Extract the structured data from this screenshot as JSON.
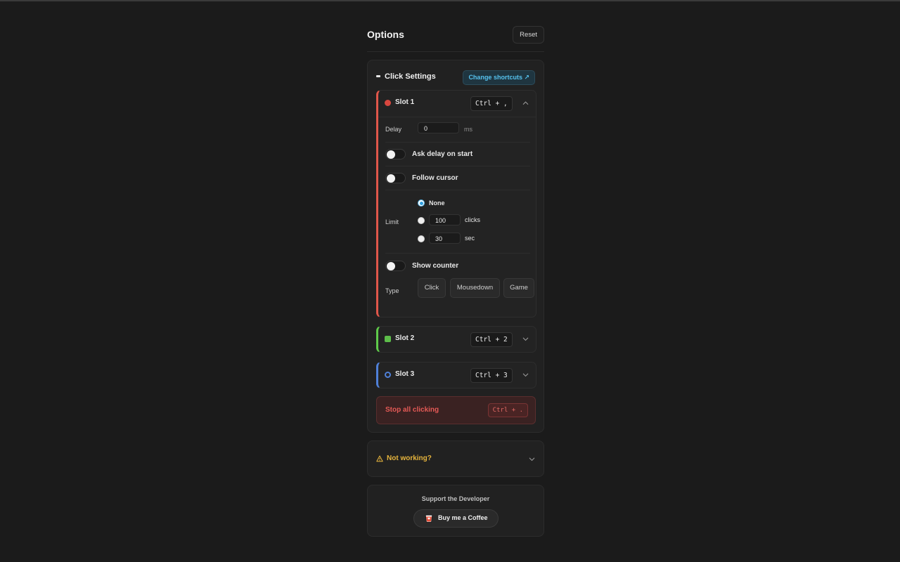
{
  "header": {
    "title": "Options",
    "reset_label": "Reset"
  },
  "click_settings": {
    "title": "Click Settings",
    "change_shortcuts_label": "Change shortcuts ↗",
    "slots": [
      {
        "name": "Slot 1",
        "shortcut": "Ctrl + ,",
        "color": "#d8473f",
        "expanded": true,
        "delay": {
          "label": "Delay",
          "value": "0",
          "unit": "ms"
        },
        "ask_delay_on_start": {
          "label": "Ask delay on start",
          "on": false
        },
        "follow_cursor": {
          "label": "Follow cursor",
          "on": false
        },
        "limit": {
          "label": "Limit",
          "selected": "None",
          "options": [
            {
              "label": "None"
            },
            {
              "value": "100",
              "unit": "clicks"
            },
            {
              "value": "30",
              "unit": "sec"
            }
          ]
        },
        "show_counter": {
          "label": "Show counter",
          "on": false
        },
        "type": {
          "label": "Type",
          "options": [
            "Click",
            "Mousedown",
            "Game"
          ]
        }
      },
      {
        "name": "Slot 2",
        "shortcut": "Ctrl + 2",
        "color": "#5dbd4a",
        "expanded": false
      },
      {
        "name": "Slot 3",
        "shortcut": "Ctrl + 3",
        "color": "#4f80d8",
        "expanded": false
      }
    ],
    "stop_all": {
      "label": "Stop all clicking",
      "shortcut": "Ctrl + ."
    }
  },
  "not_working": {
    "label": "Not working?"
  },
  "support": {
    "title": "Support the Developer",
    "button_label": "Buy me a Coffee"
  },
  "colors": {
    "accent_blue": "#56c2ee",
    "warning": "#e6b43d",
    "danger": "#e55a56"
  }
}
